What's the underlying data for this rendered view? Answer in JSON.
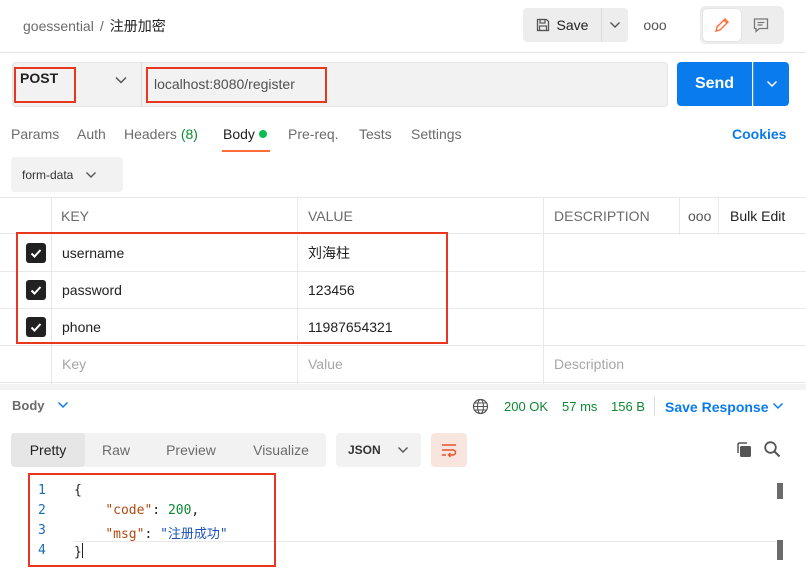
{
  "header": {
    "workspace": "goessential",
    "separator": "/",
    "request_name": "注册加密",
    "save_label": "Save",
    "more_label": "ooo"
  },
  "request": {
    "method": "POST",
    "url": "localhost:8080/register",
    "send_label": "Send"
  },
  "tabs": [
    {
      "label": "Params"
    },
    {
      "label": "Auth"
    },
    {
      "label": "Headers",
      "count": "(8)"
    },
    {
      "label": "Body"
    },
    {
      "label": "Pre-req."
    },
    {
      "label": "Tests"
    },
    {
      "label": "Settings"
    }
  ],
  "cookies_label": "Cookies",
  "body_mode": "form-data",
  "table": {
    "headers": [
      "KEY",
      "VALUE",
      "DESCRIPTION",
      "ooo",
      "Bulk Edit"
    ],
    "rows": [
      {
        "key": "username",
        "value": "刘海柱",
        "checked": true
      },
      {
        "key": "password",
        "value": "123456",
        "checked": true
      },
      {
        "key": "phone",
        "value": "11987654321",
        "checked": true
      }
    ],
    "placeholder": {
      "key": "Key",
      "value": "Value",
      "description": "Description"
    }
  },
  "response": {
    "section_label": "Body",
    "status": "200 OK",
    "time": "57 ms",
    "size": "156 B",
    "save_label": "Save Response",
    "views": [
      "Pretty",
      "Raw",
      "Preview",
      "Visualize"
    ],
    "active_view": "Pretty",
    "format": "JSON",
    "line_numbers": [
      "1",
      "2",
      "3",
      "4"
    ],
    "code": {
      "open": "{",
      "code_key": "\"code\"",
      "code_value": "200",
      "msg_key": "\"msg\"",
      "msg_value": "\"注册成功\"",
      "close": "}",
      "colon": ": ",
      "comma": ","
    }
  },
  "colors": {
    "accent": "#ff6c37",
    "send": "#097bed",
    "highlight_box": "#e8371e",
    "status_ok": "#0c8a33"
  }
}
